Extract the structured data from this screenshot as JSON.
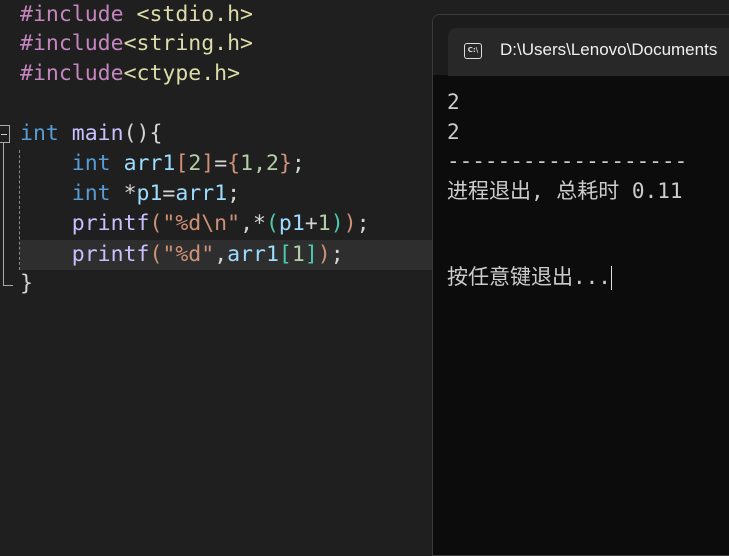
{
  "editor": {
    "lines": [
      [
        "#include",
        " <stdio.h>"
      ],
      [
        "#include",
        "<string.h>"
      ],
      [
        "#include",
        "<ctype.h>"
      ],
      {
        "int": "int",
        "main": "main",
        "rest": "(){"
      },
      {
        "int": "int",
        "arr": "arr1",
        "lb": "[",
        "n2": "2",
        "rb": "]",
        "eq": "=",
        "lc": "{",
        "v": "1,2",
        "rc": "}",
        "semi": ";"
      },
      {
        "int": "int",
        "ptr": " *",
        "p1": "p1",
        "eq": "=",
        "arr": "arr1",
        "semi": ";"
      },
      {
        "fn": "printf",
        "lp": "(",
        "str": "\"%d\\n\"",
        "comma": ",*",
        "lp2": "(",
        "p1": "p1",
        "plus": "+",
        "one": "1",
        "rp2": ")",
        "rp": ")",
        "semi": ";"
      },
      {
        "fn": "printf",
        "lp": "(",
        "str": "\"%d\"",
        "comma": ",",
        "arr": "arr1",
        "lb": "[",
        "one": "1",
        "rb": "]",
        "rp": ")",
        "semi": ";"
      },
      "}"
    ]
  },
  "terminal": {
    "title": "D:\\Users\\Lenovo\\Documents",
    "icon": "C:\\",
    "output": [
      "2",
      "2",
      "-------------------",
      "进程退出, 总耗时 0.11",
      "按任意键退出..."
    ]
  }
}
